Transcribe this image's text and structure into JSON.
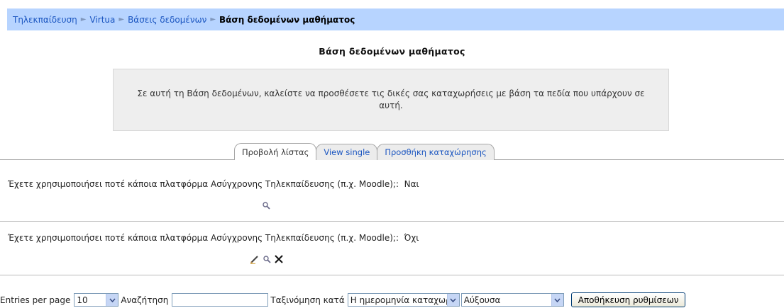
{
  "breadcrumb": {
    "items": [
      "Τηλεκπαίδευση",
      "Virtua",
      "Βάσεις δεδομένων"
    ],
    "separator": "►",
    "current": "Βάση δεδομένων μαθήματος"
  },
  "page_title": "Βάση δεδομένων μαθήματος",
  "intro_text": "Σε αυτή τη Βάση δεδομένων, καλείστε να προσθέσετε τις δικές σας καταχωρήσεις με βάση τα πεδία που υπάρχουν σε αυτή.",
  "tabs": [
    {
      "label": "Προβολή λίστας",
      "active": true
    },
    {
      "label": "View single",
      "active": false
    },
    {
      "label": "Προσθήκη καταχώρησης",
      "active": false
    }
  ],
  "entries": [
    {
      "question": "Έχετε χρησιμοποιήσει ποτέ κάποια πλατφόρμα Ασύγχρονης Τηλεκπαίδευσης (π.χ. Moodle);:",
      "answer": "Ναι",
      "icons": [
        "view-icon"
      ]
    },
    {
      "question": "Έχετε χρησιμοποιήσει ποτέ κάποια πλατφόρμα Ασύγχρονης Τηλεκπαίδευσης (π.χ. Moodle);:",
      "answer": "Όχι",
      "icons": [
        "edit-icon",
        "view-icon",
        "delete-icon"
      ]
    }
  ],
  "footer": {
    "entries_per_page_label": "Entries per page",
    "entries_per_page_value": "10",
    "search_label": "Αναζήτηση",
    "search_value": "",
    "sort_label": "Ταξινόμηση κατά",
    "sort_field_value": "Η ημερομηνία καταχωρήθηκε",
    "sort_order_value": "Αύξουσα",
    "save_button": "Αποθήκευση ρυθμίσεων"
  },
  "colors": {
    "navbar_bg": "#b7d4ff",
    "link": "#1a55c0",
    "intro_bg": "#eeeeee"
  }
}
